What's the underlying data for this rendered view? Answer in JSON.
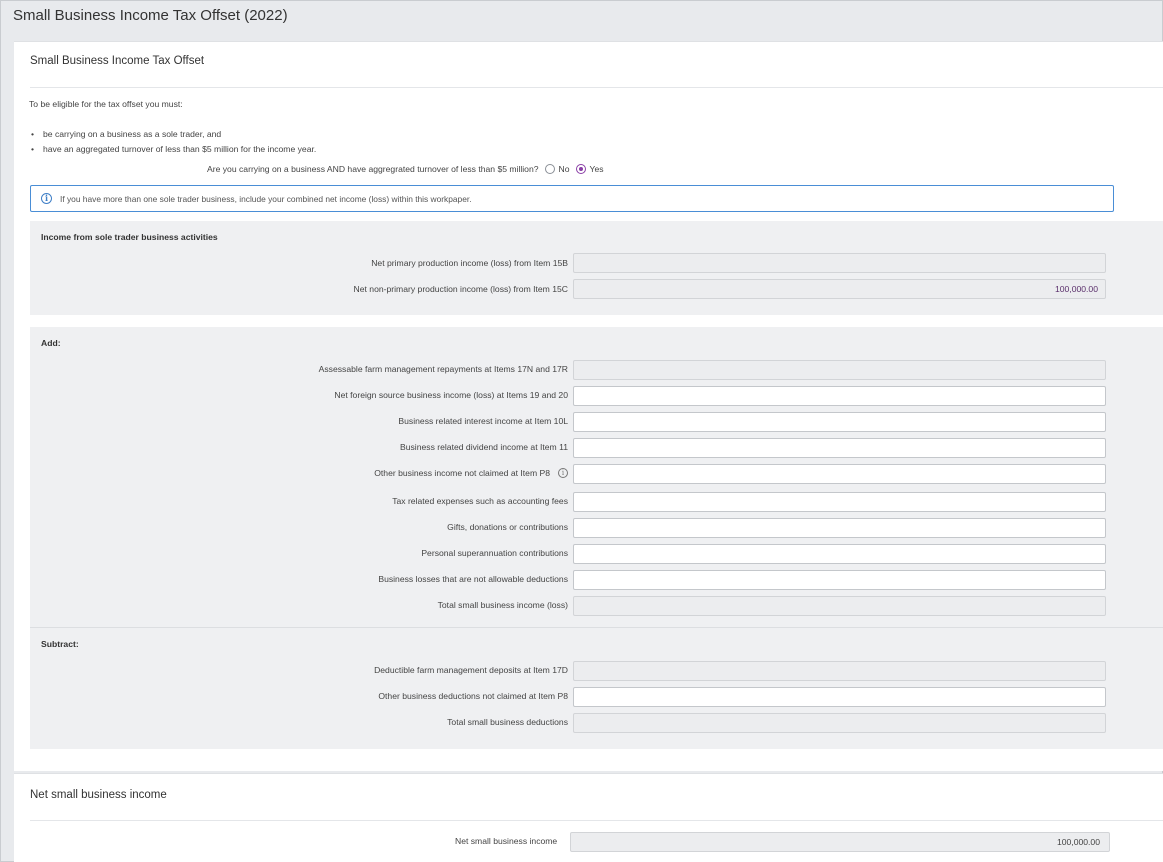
{
  "page_title": "Small Business Income Tax Offset (2022)",
  "card1_title": "Small Business Income Tax Offset",
  "intro_text": "To be eligible for the tax offset you must:",
  "bullets": [
    "be carrying on a business as a sole trader, and",
    "have an aggregated turnover of less than $5 million for the income year."
  ],
  "question": {
    "text": "Are you carrying on a business AND have aggregrated turnover of less than $5 million?",
    "options": [
      "No",
      "Yes"
    ],
    "selected": "Yes"
  },
  "info_box": "If you have more than one sole trader business, include your combined net income (loss) within this workpaper.",
  "income_section": {
    "heading": "Income from sole trader business activities",
    "fields": [
      {
        "label": "Net primary production income (loss) from Item 15B",
        "value": ""
      },
      {
        "label": "Net non-primary production income (loss) from Item 15C",
        "value": "100,000.00"
      }
    ]
  },
  "add_section": {
    "heading": "Add:",
    "fields": [
      {
        "label": "Assessable farm management repayments at Items 17N and 17R",
        "value": ""
      },
      {
        "label": "Net foreign source business income (loss) at Items 19 and 20",
        "value": ""
      },
      {
        "label": "Business related interest income at Item 10L",
        "value": ""
      },
      {
        "label": "Business related dividend income at Item 11",
        "value": ""
      },
      {
        "label": "Other business income not claimed at Item P8",
        "value": ""
      },
      {
        "label": "Tax related expenses such as accounting fees",
        "value": ""
      },
      {
        "label": "Gifts, donations or contributions",
        "value": ""
      },
      {
        "label": "Personal superannuation contributions",
        "value": ""
      },
      {
        "label": "Business losses that are not allowable deductions",
        "value": ""
      },
      {
        "label": "Total small business income (loss)",
        "value": ""
      }
    ]
  },
  "subtract_section": {
    "heading": "Subtract:",
    "fields": [
      {
        "label": "Deductible farm management deposits at Item 17D",
        "value": ""
      },
      {
        "label": "Other business deductions not claimed at Item P8",
        "value": ""
      },
      {
        "label": "Total small business deductions",
        "value": ""
      }
    ]
  },
  "card2_title": "Net small business income",
  "net_income": {
    "label": "Net small business income",
    "value": "100,000.00"
  },
  "colors": {
    "accent": "#8a3fa6",
    "info_border": "#4a8ed6"
  },
  "icons": {
    "info": "info-circle-icon"
  }
}
